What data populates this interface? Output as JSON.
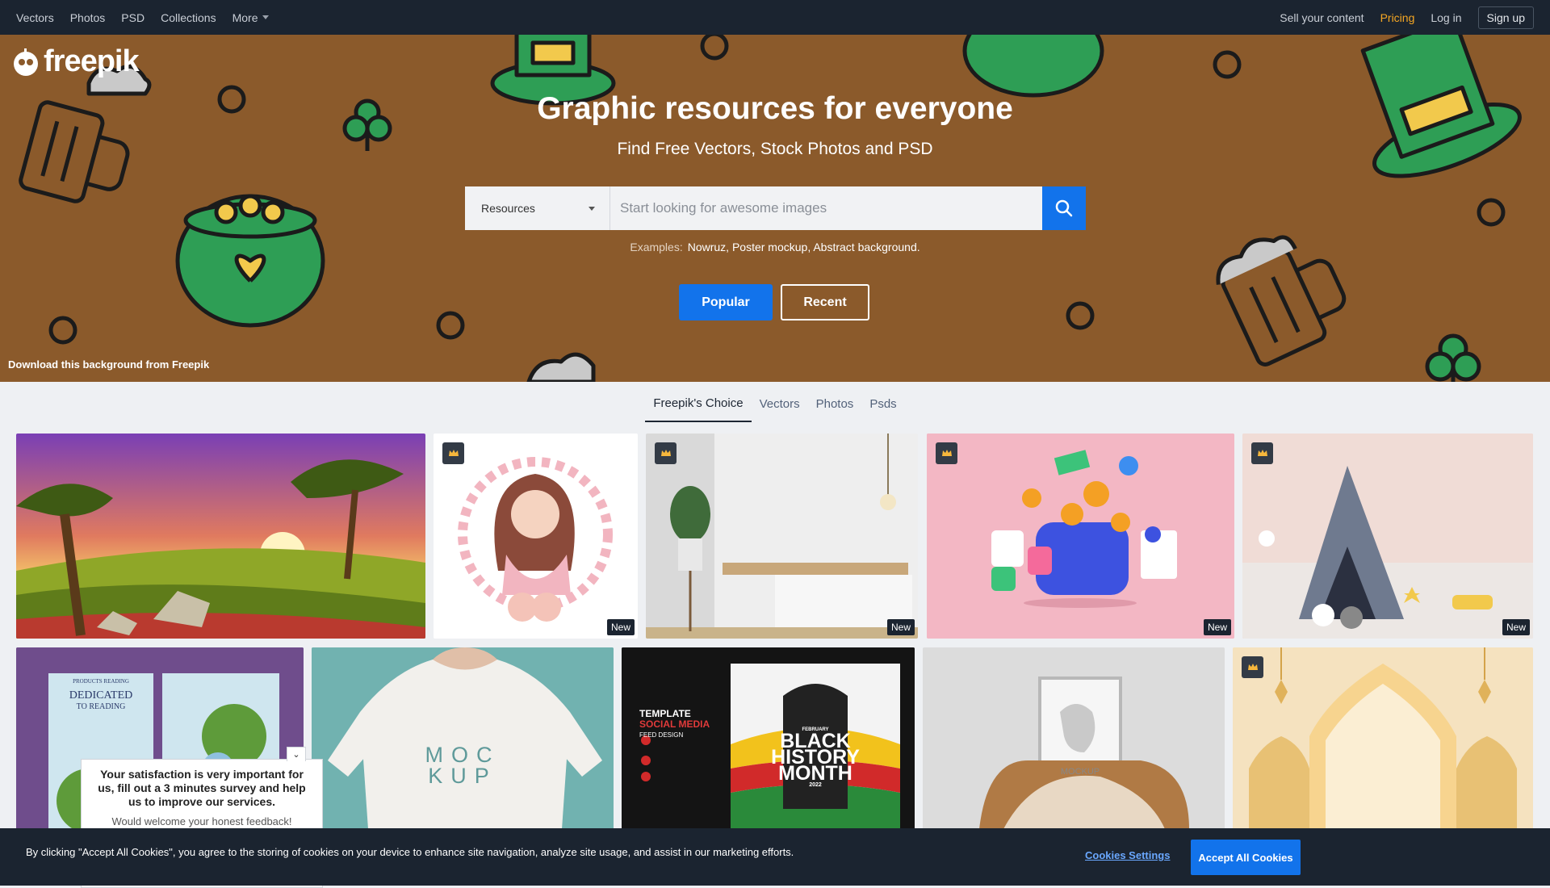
{
  "nav": {
    "left": [
      {
        "label": "Vectors"
      },
      {
        "label": "Photos"
      },
      {
        "label": "PSD"
      },
      {
        "label": "Collections"
      },
      {
        "label": "More"
      }
    ],
    "right": {
      "sell": "Sell your content",
      "pricing": "Pricing",
      "login": "Log in",
      "signup": "Sign up"
    },
    "pricing_color": "#f6a723"
  },
  "hero": {
    "logo_text": "freepik",
    "title": "Graphic resources for everyone",
    "subtitle": "Find Free Vectors, Stock Photos and PSD",
    "resource_select": "Resources",
    "search_placeholder": "Start looking for awesome images",
    "examples_label": "Examples:",
    "examples_links": "Nowruz, Poster mockup, Abstract background.",
    "popular_button": "Popular",
    "recent_button": "Recent",
    "credit": "Download this background from Freepik",
    "background_color": "#8b5a2b"
  },
  "tabs": [
    {
      "label": "Freepik's Choice",
      "active": true
    },
    {
      "label": "Vectors"
    },
    {
      "label": "Photos"
    },
    {
      "label": "Psds"
    }
  ],
  "gallery": {
    "new_badge": "New",
    "mockup_text_1": "MOC",
    "mockup_text_2": "KUP",
    "frame_mockup": "MOCKUP",
    "book_title": "DEDICATED",
    "book_sub": "TO READING",
    "book_author": "PRODUCTS READING",
    "poster_template": "TEMPLATE",
    "poster_social": "SOCIAL MEDIA",
    "poster_feed": "FEED DESIGN",
    "poster_month": "FEBRUARY",
    "poster_black": "BLACK",
    "poster_history": "HISTORY",
    "poster_mo": "MONTH",
    "poster_year": "2022"
  },
  "survey": {
    "message": "Your satisfaction is very important for us, fill out a 3 minutes survey and help us to improve our services.",
    "sub": "Would welcome your honest feedback!"
  },
  "cookie": {
    "text": "By clicking \"Accept All Cookies\", you agree to the storing of cookies on your device to enhance site navigation, analyze site usage, and assist in our marketing efforts.",
    "settings": "Cookies Settings",
    "accept": "Accept All Cookies"
  },
  "accent_color": "#1273eb"
}
